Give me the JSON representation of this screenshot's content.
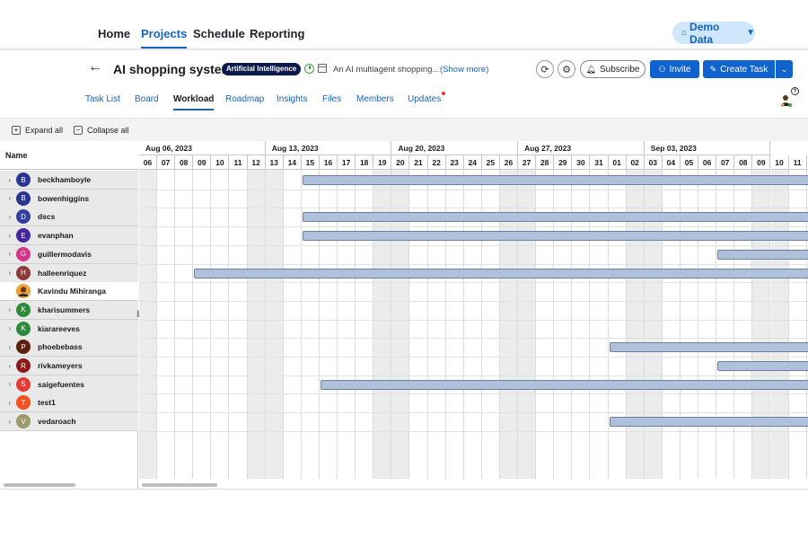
{
  "nav": {
    "items": [
      {
        "label": "Home",
        "active": false
      },
      {
        "label": "Projects",
        "active": true
      },
      {
        "label": "Schedule",
        "active": false
      },
      {
        "label": "Reporting",
        "active": false
      }
    ],
    "demo_label": "Demo Data"
  },
  "project": {
    "title": "AI shopping system",
    "category": "Artificial Intelligence",
    "description": "An AI multiagent shopping...",
    "show_more": "(Show more)",
    "subscribe_label": "Subscribe",
    "invite_label": "Invite",
    "create_task_label": "Create Task"
  },
  "tabs": [
    {
      "label": "Task List",
      "active": false
    },
    {
      "label": "Board",
      "active": false
    },
    {
      "label": "Workload",
      "active": true
    },
    {
      "label": "Roadmap",
      "active": false
    },
    {
      "label": "Insights",
      "active": false
    },
    {
      "label": "Files",
      "active": false
    },
    {
      "label": "Members",
      "active": false
    },
    {
      "label": "Updates",
      "active": false,
      "notification": true
    }
  ],
  "toolbar": {
    "expand_all": "Expand all",
    "collapse_all": "Collapse all"
  },
  "grid": {
    "name_header": "Name",
    "weeks": [
      "Aug 06, 2023",
      "Aug 13, 2023",
      "Aug 20, 2023",
      "Aug 27, 2023",
      "Sep 03, 2023"
    ],
    "days": [
      "06",
      "07",
      "08",
      "09",
      "10",
      "11",
      "12",
      "13",
      "14",
      "15",
      "16",
      "17",
      "18",
      "19",
      "20",
      "21",
      "22",
      "23",
      "24",
      "25",
      "26",
      "27",
      "28",
      "29",
      "30",
      "31",
      "01",
      "02",
      "03",
      "04",
      "05",
      "06",
      "07",
      "08",
      "09",
      "10",
      "11"
    ],
    "members": [
      {
        "initial": "B",
        "name": "beckhamboyle",
        "color": "#283593",
        "expandable": true,
        "bar_start_day": "15"
      },
      {
        "initial": "B",
        "name": "bowenhiggins",
        "color": "#283593",
        "expandable": true,
        "bar_start_day": null
      },
      {
        "initial": "D",
        "name": "dscs",
        "color": "#303f9f",
        "expandable": true,
        "bar_start_day": "15"
      },
      {
        "initial": "E",
        "name": "evanphan",
        "color": "#4527a0",
        "expandable": true,
        "bar_start_day": "15"
      },
      {
        "initial": "G",
        "name": "guillermodavis",
        "color": "#d6338a",
        "expandable": true,
        "bar_start_day": "07"
      },
      {
        "initial": "H",
        "name": "halleenriquez",
        "color": "#8d3a3a",
        "expandable": true,
        "bar_start_day": "09"
      },
      {
        "initial": "",
        "name": "Kavindu Mihiranga",
        "color": "#f0a33a",
        "expandable": false,
        "photo": true,
        "bar_start_day": null
      },
      {
        "initial": "K",
        "name": "kharisummers",
        "color": "#2e8b3a",
        "expandable": true,
        "bar_start_day": null
      },
      {
        "initial": "K",
        "name": "kiarareeves",
        "color": "#2e8b3a",
        "expandable": true,
        "bar_start_day": null
      },
      {
        "initial": "P",
        "name": "phoebebass",
        "color": "#5d1f0b",
        "expandable": true,
        "bar_start_day": "01"
      },
      {
        "initial": "R",
        "name": "rivkameyers",
        "color": "#8b1a1a",
        "expandable": true,
        "bar_start_day": "07"
      },
      {
        "initial": "S",
        "name": "saigefuentes",
        "color": "#e53935",
        "expandable": true,
        "bar_start_day": "16"
      },
      {
        "initial": "T",
        "name": "test1",
        "color": "#f4511e",
        "expandable": true,
        "bar_start_day": null
      },
      {
        "initial": "V",
        "name": "vedaroach",
        "color": "#9a9a6a",
        "expandable": true,
        "bar_start_day": "01"
      }
    ]
  },
  "colors": {
    "accent": "#1565c0",
    "button_primary": "#1063ce",
    "bar_fill": "#b0c2db"
  }
}
